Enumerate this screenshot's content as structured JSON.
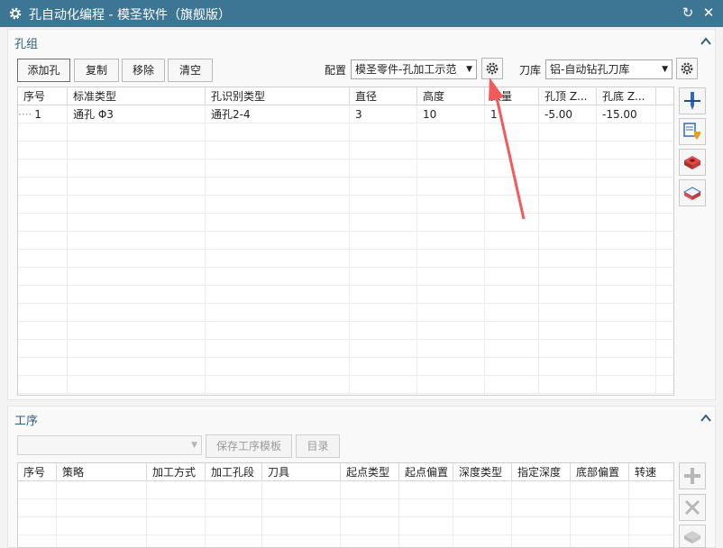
{
  "window": {
    "title": "孔自动化编程 - 模圣软件（旗舰版）",
    "gear_icon": "gear-icon",
    "restore_icon": "reset-icon",
    "close_icon": "close-icon"
  },
  "hole_group": {
    "title": "孔组",
    "buttons": {
      "add": "添加孔",
      "copy": "复制",
      "remove": "移除",
      "clear": "清空"
    },
    "config_label": "配置",
    "config_value": "模圣零件-孔加工示范",
    "tool_lib_label": "刀库",
    "tool_lib_value": "铝-自动钻孔刀库",
    "columns": [
      "序号",
      "标准类型",
      "孔识别类型",
      "直径",
      "高度",
      "数量",
      "孔顶 Z...",
      "孔底 Z..."
    ],
    "rows": [
      {
        "index": "1",
        "std_type": "通孔 Φ3",
        "recog_type": "通孔2-4",
        "diameter": "3",
        "height": "10",
        "qty": "1",
        "top_z": "-5.00",
        "bottom_z": "-15.00"
      }
    ],
    "side_tools": [
      "drill-icon",
      "tool-library-icon",
      "pocket-face-icon",
      "wire-face-icon"
    ]
  },
  "process": {
    "title": "工序",
    "template_value": "",
    "save_template": "保存工序模板",
    "catalog": "目录",
    "columns": [
      "序号",
      "策略",
      "加工方式",
      "加工孔段",
      "刀具",
      "起点类型",
      "起点偏置",
      "深度类型",
      "指定深度",
      "底部偏置",
      "转速"
    ],
    "side_tools": [
      "add-icon",
      "delete-icon",
      "layer-icon"
    ]
  },
  "colors": {
    "titlebar": "#3d7594",
    "section_title": "#2f5f7c",
    "annotation_arrow": "#f25b5b"
  }
}
